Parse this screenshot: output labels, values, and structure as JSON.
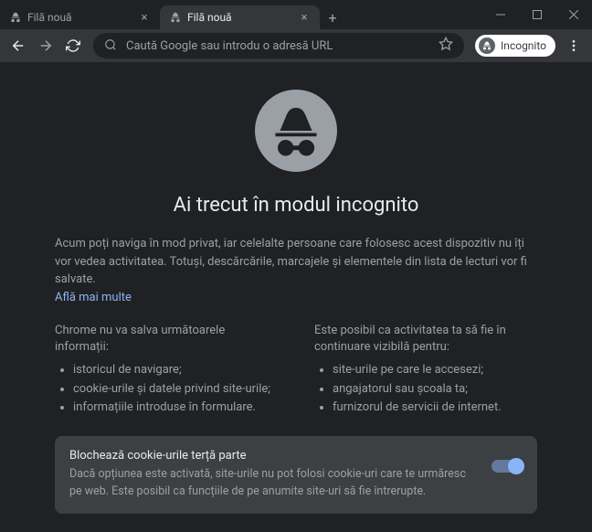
{
  "tabs": [
    {
      "label": "Filă nouă",
      "active": false
    },
    {
      "label": "Filă nouă",
      "active": true
    }
  ],
  "omnibox": {
    "placeholder": "Caută Google sau introdu o adresă URL"
  },
  "incognito_badge": "Incognito",
  "page": {
    "title": "Ai trecut în modul incognito",
    "intro": "Acum poți naviga în mod privat, iar celelalte persoane care folosesc acest dispozitiv nu îți vor vedea activitatea. Totuși, descărcările, marcajele și elementele din lista de lecturi vor fi salvate.",
    "learn_more": "Află mai multe",
    "left": {
      "head": "Chrome nu va salva următoarele informații:",
      "items": [
        "istoricul de navigare;",
        "cookie-urile și datele privind site-urile;",
        "informațiile introduse în formulare."
      ]
    },
    "right": {
      "head": "Este posibil ca activitatea ta să fie în continuare vizibilă pentru:",
      "items": [
        "site-urile pe care le accesezi;",
        "angajatorul sau școala ta;",
        "furnizorul de servicii de internet."
      ]
    },
    "cookie": {
      "title": "Blochează cookie-urile terță parte",
      "desc": "Dacă opțiunea este activată, site-urile nu pot folosi cookie-uri care te urmăresc pe web. Este posibil ca funcțiile de pe anumite site-uri să fie întrerupte."
    }
  }
}
